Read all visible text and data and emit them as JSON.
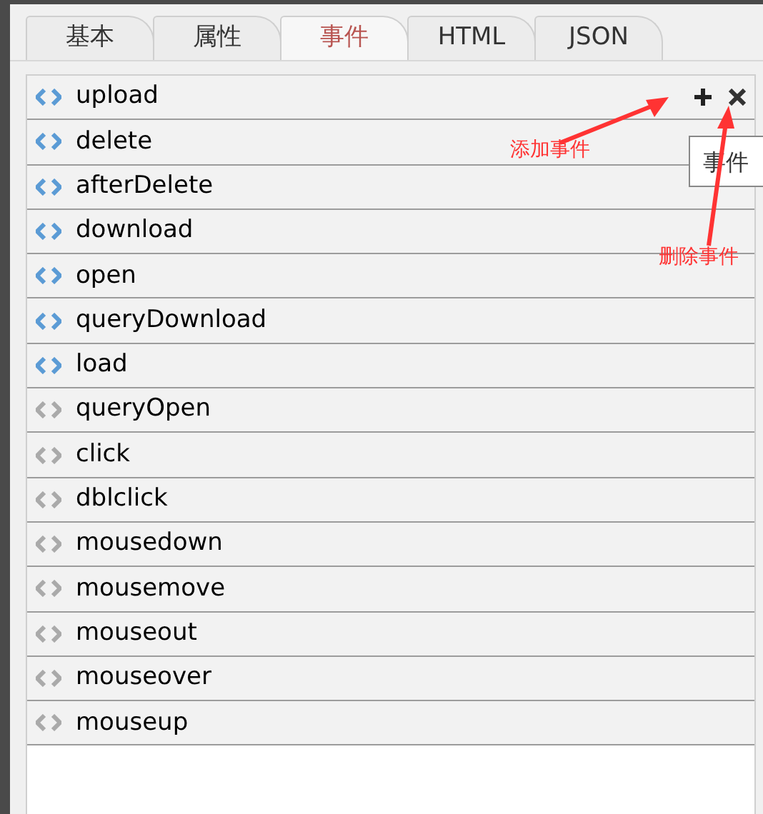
{
  "tabs": [
    {
      "label": "基本",
      "selected": false
    },
    {
      "label": "属性",
      "selected": false
    },
    {
      "label": "事件",
      "selected": true
    },
    {
      "label": "HTML",
      "selected": false
    },
    {
      "label": "JSON",
      "selected": false
    }
  ],
  "events": [
    {
      "name": "upload",
      "defined": true,
      "hovered": true
    },
    {
      "name": "delete",
      "defined": true,
      "hovered": false
    },
    {
      "name": "afterDelete",
      "defined": true,
      "hovered": false
    },
    {
      "name": "download",
      "defined": true,
      "hovered": false
    },
    {
      "name": "open",
      "defined": true,
      "hovered": false
    },
    {
      "name": "queryDownload",
      "defined": true,
      "hovered": false
    },
    {
      "name": "load",
      "defined": true,
      "hovered": false
    },
    {
      "name": "queryOpen",
      "defined": false,
      "hovered": false
    },
    {
      "name": "click",
      "defined": false,
      "hovered": false
    },
    {
      "name": "dblclick",
      "defined": false,
      "hovered": false
    },
    {
      "name": "mousedown",
      "defined": false,
      "hovered": false
    },
    {
      "name": "mousemove",
      "defined": false,
      "hovered": false
    },
    {
      "name": "mouseout",
      "defined": false,
      "hovered": false
    },
    {
      "name": "mouseover",
      "defined": false,
      "hovered": false
    },
    {
      "name": "mouseup",
      "defined": false,
      "hovered": false
    }
  ],
  "tooltip": {
    "text": "事件"
  },
  "annotations": [
    {
      "kind": "add",
      "text": "添加事件"
    },
    {
      "kind": "delete",
      "text": "删除事件"
    }
  ]
}
